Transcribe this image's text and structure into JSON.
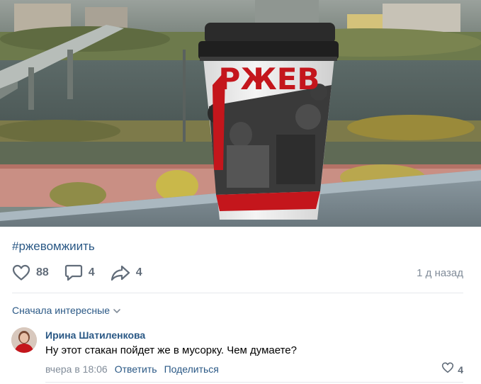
{
  "post": {
    "photo_cup_text": "РЖЕВ",
    "hashtag": "#ржевомжиить",
    "likes": "88",
    "comments": "4",
    "shares": "4",
    "time": "1 д назад"
  },
  "comments_section": {
    "sort_label": "Сначала интересные",
    "items": [
      {
        "author": "Ирина Шатиленкова",
        "text": "Ну этот стакан пойдет же в мусорку. Чем думаете?",
        "date": "вчера в 18:06",
        "reply_label": "Ответить",
        "share_label": "Поделиться",
        "likes": "4"
      }
    ]
  },
  "colors": {
    "link": "#2a5885",
    "secondary": "#818c99",
    "icon": "#626d7a",
    "cup_red": "#c4161c"
  },
  "icons": [
    "heart-icon",
    "comment-icon",
    "share-icon",
    "chevron-down-icon"
  ]
}
